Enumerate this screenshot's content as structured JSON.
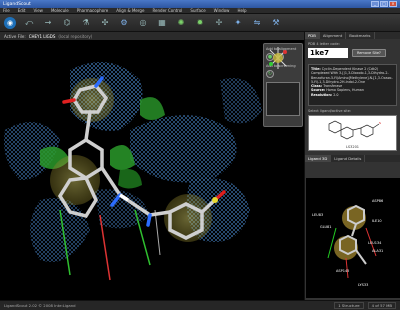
{
  "window": {
    "title": "LigandScout"
  },
  "menu": [
    "File",
    "Edit",
    "View",
    "Molecule",
    "Pharmacophore",
    "Align & Merge",
    "Render Control",
    "Surface",
    "Window",
    "Help"
  ],
  "toolbar_icons": [
    "logo-icon",
    "open-icon",
    "arrow-icon",
    "molecule-icon",
    "flask-icon",
    "atom-icon",
    "pharmacophore-icon",
    "sphere-icon",
    "surface-icon",
    "star-icon",
    "gear-icon",
    "molecule-network-icon",
    "hydrophobic-icon",
    "compare-icon",
    "settings-icon"
  ],
  "infobar": {
    "label": "Active File:",
    "file": "CHEY1 LIGDS",
    "note": "(local repository)"
  },
  "sidepanel": {
    "align_label": "Add to alignment",
    "screen_label": "Add to screening"
  },
  "rightpanel": {
    "tabs": [
      "PDB",
      "Alignment",
      "Bookmarks"
    ],
    "pdb_label": "PDB 4 letter code:",
    "pdb_code": "1ke7",
    "remove_label": "Remove Site?",
    "details": {
      "title_label": "Title:",
      "title": "Cyclin-Dependent Kinase 2 (Cdk2) Complexed With 3-[(1,3-Dioxolo-1,3-Dihydro-2-Benzofuran-5-Yl)Amino]Methylene]-N-[1,3-Oxazo-5-Yl)-1,3-Dihydro-2H-Indol-2-One",
      "class_label": "Class:",
      "class": "Transferase",
      "source_label": "Source:",
      "source": "Homo Sapiens, Human",
      "resolution_label": "Resolution:",
      "resolution": "2.0"
    },
    "ligand_select_label": "Select ligand/active site:",
    "ligand_name": "LS3201",
    "bottom_tabs": [
      "Ligand 3D",
      "Ligand Details"
    ]
  },
  "ligand_labels": [
    "ASP86",
    "LEU83",
    "GLU81",
    "ILE10",
    "LEU134",
    "ALA31",
    "ASP145",
    "LYS33"
  ],
  "status": {
    "left": "LigandScout 2.02 © 2008 Inte:Ligand",
    "right_1": "1 Structure",
    "right_2": "4 of 57 MB"
  }
}
